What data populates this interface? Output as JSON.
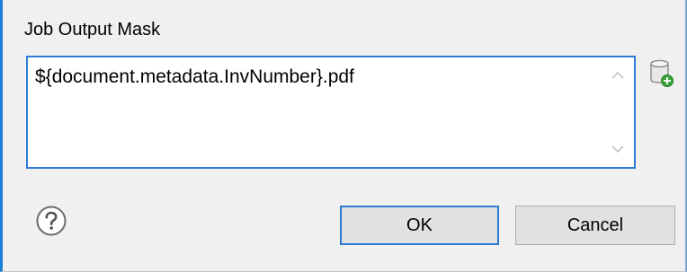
{
  "dialog": {
    "field_label": "Job Output Mask",
    "mask_value": "${document.metadata.InvNumber}.pdf",
    "ok_label": "OK",
    "cancel_label": "Cancel"
  },
  "icons": {
    "variable": "database-add-icon",
    "help": "help-icon",
    "scroll_up": "chevron-up-icon",
    "scroll_down": "chevron-down-icon"
  },
  "colors": {
    "accent": "#2e7bd4",
    "window_bg": "#f0f0f0",
    "button_bg": "#e1e1e1"
  }
}
